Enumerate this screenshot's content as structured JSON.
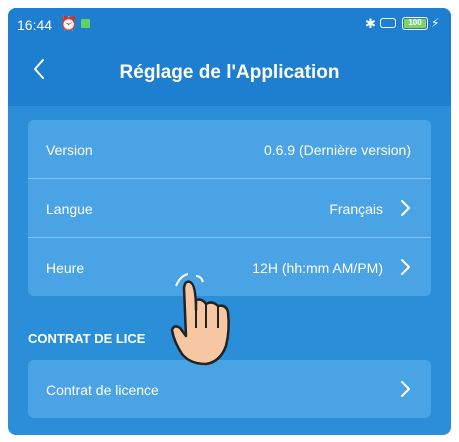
{
  "status": {
    "time": "16:44",
    "battery": "100"
  },
  "header": {
    "title": "Réglage de l'Application"
  },
  "settings": {
    "rows": [
      {
        "label": "Version",
        "value": "0.6.9 (Dernière version)"
      },
      {
        "label": "Langue",
        "value": "Français"
      },
      {
        "label": "Heure",
        "value": "12H (hh:mm AM/PM)"
      }
    ]
  },
  "license_section": {
    "title": "CONTRAT DE LICE",
    "row_label": "Contrat de licence"
  },
  "colors": {
    "header_bg": "#1e7fd1",
    "page_bg": "#2a8fd8",
    "card_bg": "#4aa3e4",
    "text": "#ffffff"
  },
  "icons": [
    "back-chevron-icon",
    "chevron-right-icon",
    "pointing-hand-icon",
    "bluetooth-icon",
    "battery-icon"
  ]
}
